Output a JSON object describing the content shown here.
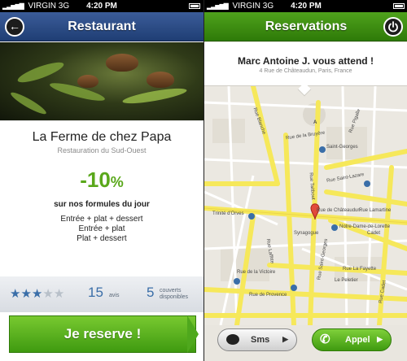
{
  "left": {
    "status": {
      "carrier": "VIRGIN",
      "network": "3G",
      "time": "4:20 PM"
    },
    "nav": {
      "title": "Restaurant",
      "back_label": "←"
    },
    "restaurant": {
      "name": "La Ferme de chez Papa",
      "cuisine": "Restauration du Sud-Ouest"
    },
    "offer": {
      "discount": "-10",
      "percent_sign": "%",
      "headline": "sur nos formules du jour",
      "lines": [
        "Entrée + plat + dessert",
        "Entrée + plat",
        "Plat + dessert"
      ]
    },
    "stats": {
      "rating": 3,
      "rating_max": 5,
      "reviews_count": "15",
      "reviews_label": "avis",
      "covers_count": "5",
      "covers_label_1": "couverts",
      "covers_label_2": "disponibles"
    },
    "reserve_button": "Je reserve !"
  },
  "right": {
    "status": {
      "carrier": "VIRGIN",
      "network": "3G",
      "time": "4:20 PM"
    },
    "nav": {
      "title": "Reservations"
    },
    "card": {
      "message": "Marc Antoine J. vous attend !",
      "address": "4 Rue de Châteaudun, Paris, France"
    },
    "map": {
      "pin_label": "A",
      "streets": [
        "Rue de Châteaudun",
        "Rue de la Bruyère",
        "Rue Saint-Lazare",
        "Rue Lamartine",
        "Rue de Provence",
        "Rue de la Victoire",
        "Rue La Fayette",
        "Rue Taitbout",
        "Rue Saint-Georges",
        "Rue Cadet",
        "Rue Laffitte",
        "Rue Pigalle",
        "Rue Blanche"
      ],
      "places": [
        "Saint-Georges",
        "Trinité d'Orves",
        "Notre-Dame-de-Lorette",
        "Synagogue",
        "Le Peletier",
        "Cadet"
      ]
    },
    "sms_button": "Sms",
    "call_button": "Appel"
  },
  "colors": {
    "left_nav": "#2a4a86",
    "right_nav": "#3d8e12",
    "accent_green": "#5aa81b",
    "accent_blue": "#3a6ea8"
  }
}
